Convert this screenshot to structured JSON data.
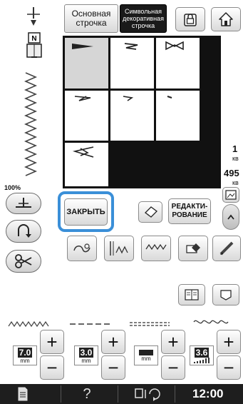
{
  "top": {
    "tab_basic": "Основная строчка",
    "tab_symbolic": "Символьная декоративная строчка"
  },
  "left": {
    "zoom_label": "100%"
  },
  "grid": {
    "close_label": "ЗАКРЫТЬ",
    "edit_label": "РЕДАКТИ-\nРОВАНИЕ"
  },
  "side": {
    "page_current": "1",
    "page_current_unit": "кв",
    "page_total": "495",
    "page_total_unit": "кв"
  },
  "settings": {
    "width_value": "7.0",
    "width_unit": "mm",
    "length_value": "3.0",
    "length_unit": "mm",
    "tension_unit": "mm",
    "tension_value": "3.6"
  },
  "status": {
    "time": "12:00"
  },
  "colors": {
    "accent": "#3a8fd8",
    "statusbar": "#1e1e1e"
  }
}
